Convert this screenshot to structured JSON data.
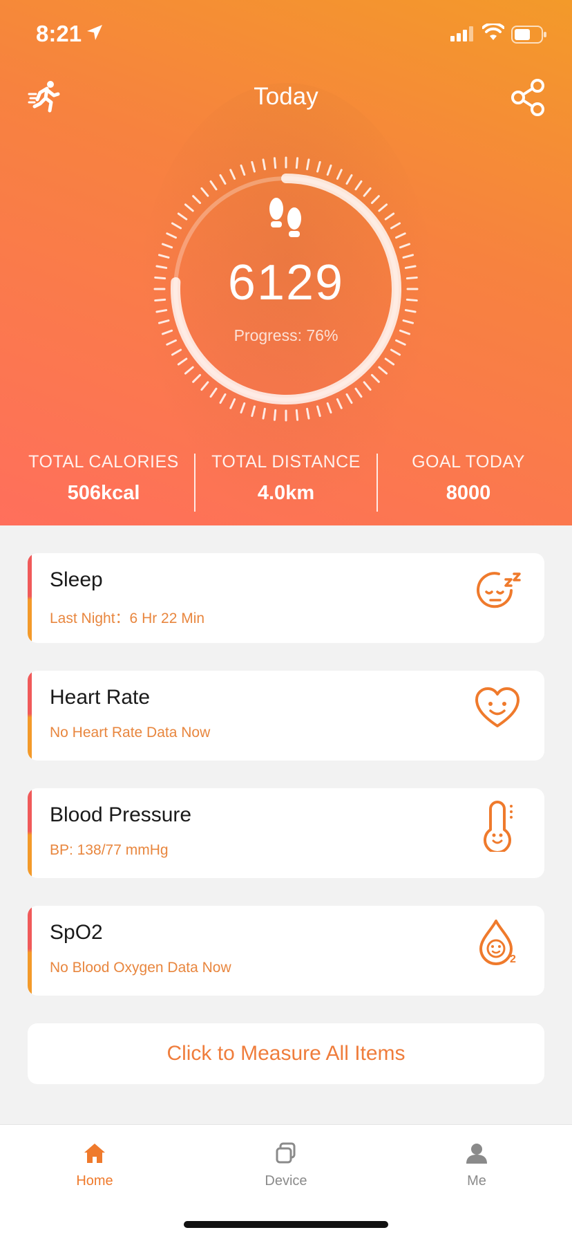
{
  "status_bar": {
    "time": "8:21"
  },
  "header": {
    "title": "Today",
    "run_icon": "running-man-icon",
    "share_icon": "share-icon"
  },
  "activity": {
    "steps": "6129",
    "progress_label": "Progress: 76%",
    "progress_fraction": 0.76,
    "steps_icon": "footprints-icon"
  },
  "stats": [
    {
      "label": "TOTAL CALORIES",
      "value": "506kcal"
    },
    {
      "label": "TOTAL DISTANCE",
      "value": "4.0km"
    },
    {
      "label": "GOAL TODAY",
      "value": "8000"
    }
  ],
  "cards": [
    {
      "title": "Sleep",
      "subtitle": "Last Night：6 Hr 22 Min",
      "icon": "sleep-face-icon"
    },
    {
      "title": "Heart Rate",
      "subtitle": "No Heart Rate Data Now",
      "icon": "heart-face-icon"
    },
    {
      "title": "Blood Pressure",
      "subtitle": "BP: 138/77 mmHg",
      "icon": "thermometer-face-icon"
    },
    {
      "title": "SpO2",
      "subtitle": "No Blood Oxygen Data Now",
      "icon": "oxygen-drop-icon"
    }
  ],
  "measure_button": "Click to Measure All Items",
  "tabs": [
    {
      "label": "Home",
      "icon": "home-icon",
      "active": true
    },
    {
      "label": "Device",
      "icon": "device-icon",
      "active": false
    },
    {
      "label": "Me",
      "icon": "person-icon",
      "active": false
    }
  ],
  "colors": {
    "accent": "#ef7a2c",
    "hero_top": "#f39a2a",
    "hero_bottom": "#ff6f5c",
    "card_text": "#e8863e"
  }
}
